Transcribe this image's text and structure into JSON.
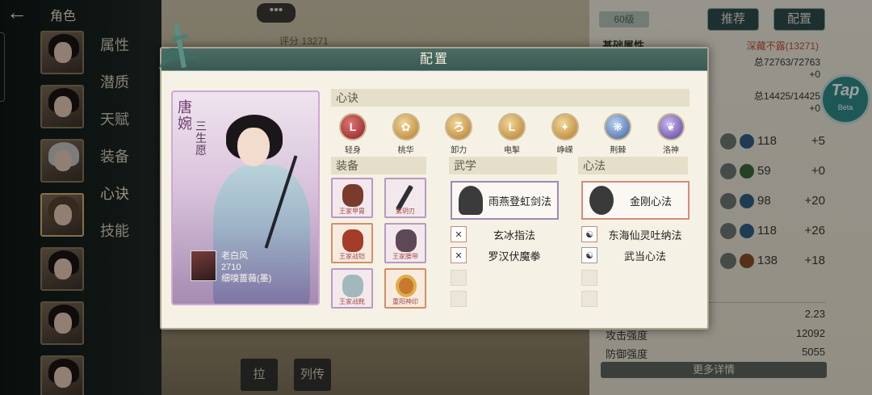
{
  "header": {
    "back_icon": "back-arrow-icon",
    "title": "角色"
  },
  "character_tabs": [
    "属性",
    "潜质",
    "天赋",
    "装备",
    "心诀",
    "技能"
  ],
  "active_tab": "心诀",
  "bubble_text": "•••",
  "score_text": "评分 13271",
  "right_panel": {
    "level": "60级",
    "recommend_label": "推荐",
    "config_label": "配置",
    "basic_attr_title": "基础属性",
    "power_hint": "深藏不露(13271)",
    "hp_text": "总72763/72763",
    "hp_bonus": "+0",
    "mp_text": "总14425/14425",
    "mp_bonus": "+0",
    "skills": [
      {
        "icon": "剑法",
        "value": "118",
        "bonus": "+5"
      },
      {
        "icon": "身行",
        "value": "59",
        "bonus": "+0"
      },
      {
        "icon": "身法",
        "value": "98",
        "bonus": "+20"
      },
      {
        "icon": "福缘",
        "value": "118",
        "bonus": "+26"
      },
      {
        "icon": "定力",
        "value": "138",
        "bonus": "+18"
      }
    ],
    "crit_value": "2.23",
    "attack_label": "攻击强度",
    "attack_value": "12092",
    "defense_label": "防御强度",
    "defense_value": "5055",
    "more_details": "更多详情"
  },
  "tap_badge": {
    "text": "Tap",
    "sub": "Beta"
  },
  "bottom_icons": [
    "拉",
    "列传"
  ],
  "modal": {
    "title": "配置",
    "character_name": "唐婉",
    "character_title": "三生愿",
    "owner": {
      "name": "老白风",
      "power": "2710",
      "tag": "细嗅蔷薇(墨)"
    },
    "xinjue_section": "心诀",
    "xinjue": [
      {
        "label": "轻身",
        "color": "red",
        "glyph": "L"
      },
      {
        "label": "桃华",
        "color": "gold",
        "glyph": ""
      },
      {
        "label": "卸力",
        "color": "gold",
        "glyph": "ろ"
      },
      {
        "label": "电掣",
        "color": "gold",
        "glyph": "L"
      },
      {
        "label": "峥嵘",
        "color": "gold",
        "glyph": ""
      },
      {
        "label": "荆棘",
        "color": "blue",
        "glyph": ""
      },
      {
        "label": "洛神",
        "color": "purple",
        "glyph": ""
      }
    ],
    "equip_section": "装备",
    "equipment": [
      {
        "name": "王家甲胄",
        "art": "armor",
        "rarity": "purple"
      },
      {
        "name": "紫玥刃",
        "art": "blade",
        "rarity": "purple"
      },
      {
        "name": "王家战铠",
        "art": "armor",
        "rarity": "gold"
      },
      {
        "name": "王家腰带",
        "art": "belt",
        "rarity": "purple"
      },
      {
        "name": "王家战靴",
        "art": "boot",
        "rarity": "purple"
      },
      {
        "name": "重阳神印",
        "art": "ring",
        "rarity": "gold"
      }
    ],
    "wuxue_section": "武学",
    "wuxue_main": "雨燕登虹剑法",
    "wuxue_subs": [
      "玄冰指法",
      "罗汉伏魔拳"
    ],
    "xinfa_section": "心法",
    "xinfa_main": "金刚心法",
    "xinfa_subs": [
      "东海仙灵吐纳法",
      "武当心法"
    ]
  }
}
